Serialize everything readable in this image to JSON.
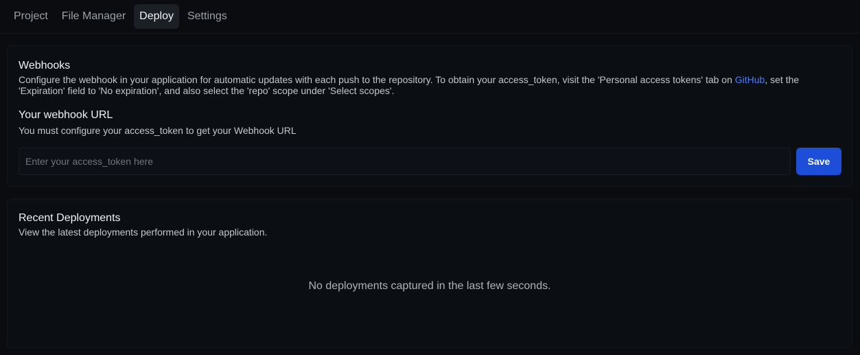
{
  "nav": {
    "tabs": [
      {
        "label": "Project"
      },
      {
        "label": "File Manager"
      },
      {
        "label": "Deploy"
      },
      {
        "label": "Settings"
      }
    ],
    "active_tab": "Deploy"
  },
  "webhooks": {
    "title": "Webhooks",
    "description_before_link": "Configure the webhook in your application for automatic updates with each push to the repository. To obtain your access_token, visit the 'Personal access tokens' tab on ",
    "link_text": "GitHub",
    "description_after_link": ", set the 'Expiration' field to 'No expiration', and also select the 'repo' scope under 'Select scopes'.",
    "url_title": "Your webhook URL",
    "url_hint": "You must configure your access_token to get your Webhook URL",
    "token_input": {
      "value": "",
      "placeholder": "Enter your access_token here"
    },
    "save_label": "Save"
  },
  "deployments": {
    "title": "Recent Deployments",
    "description": "View the latest deployments performed in your application.",
    "empty_message": "No deployments captured in the last few seconds."
  },
  "colors": {
    "background": "#0a0c10",
    "accent": "#1d4ed8",
    "link": "#4d7ef0"
  }
}
